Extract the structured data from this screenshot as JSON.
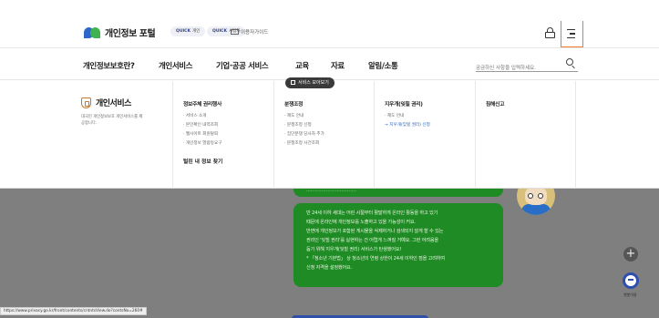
{
  "header": {
    "logo_text": "개인정보 포털",
    "quick_links": [
      {
        "prefix": "QUICK",
        "label": "개인"
      },
      {
        "prefix": "QUICK",
        "label": "사업자"
      }
    ],
    "guide_label": "이용자가이드"
  },
  "nav": {
    "items": [
      "개인정보보호란?",
      "개인서비스",
      "기업·공공 서비스",
      "교육",
      "자료",
      "알림/소통"
    ],
    "active": "개인서비스",
    "search_placeholder": "궁금하신 사항을 입력하세요."
  },
  "sitemap_label": "서비스 모아보기",
  "mega_menu": {
    "title": "개인서비스",
    "description": "대국민 개인정보보호 개인서비스를 제공합니다.",
    "columns": [
      {
        "heading": "정보주체 권리행사",
        "links": [
          "· 서비스 소개",
          "· 본인확인 내역조회",
          "· 웹사이트 회원탈퇴",
          "· 개인정보 열람등요구"
        ],
        "heading2": "털린 내 정보 찾기"
      },
      {
        "heading": "분쟁조정",
        "links": [
          "· 제도 안내",
          "· 분쟁조정 신청",
          "· 집단분쟁 당사자 추가",
          "· 분쟁조정 사건조회"
        ]
      },
      {
        "heading": "지우개(잊힐 권리)",
        "links": [
          "· 제도 안내"
        ],
        "highlight_link": "→ 지우개(잊힐 권리) 신청"
      },
      {
        "heading": "침해신고",
        "links": []
      }
    ]
  },
  "chat": {
    "partial_line": "……………………………",
    "lines": [
      "만 24세 이하 세대는 어린 시절부터 활발하게 온라인 활동을 하고 있기",
      "때문에 온라인에 개인정보를 노출하고 있을 가능성이 커요.",
      "반면에 개인정보가 포함된 게시물을 삭제하거나 검색되지 않게 할 수 있는",
      "권리인 '잊힐 권리'를 실현하는 건 어렵게 느껴질 거예요. 그런 어려움을",
      "돕기 위해 지우개(잊힐 권리) 서비스가 탄생했어요!",
      "* 「청소년 기본법」 상 청소년의 연령 상한이 24세 이하인 점을 고려하여",
      "신청 자격을 설정했어요."
    ]
  },
  "chatbot_label": "챗봇이용",
  "status_url": "https://www.privacy.go.kr/front/contents/cntntsView.do?contsNo=260#"
}
